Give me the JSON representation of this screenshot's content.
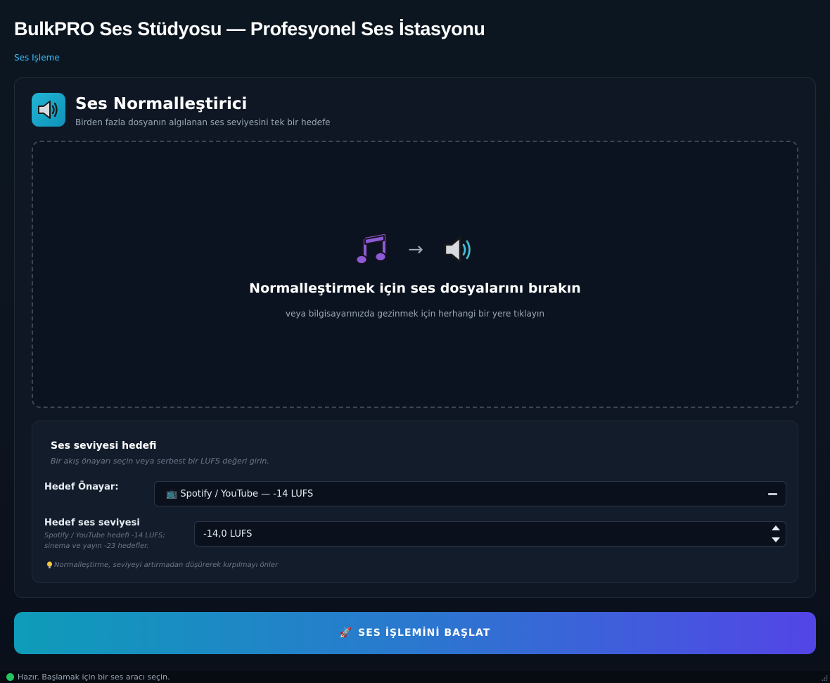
{
  "app": {
    "title": "BulkPRO Ses Stüdyosu — Profesyonel Ses İstasyonu",
    "breadcrumb": "Ses Işleme"
  },
  "tool": {
    "icon": "speaker-icon",
    "title": "Ses Normalleştirici",
    "subtitle": "Birden fazla dosyanın algılanan ses seviyesini tek bir hedefe"
  },
  "dropzone": {
    "icon_left": "music-note-icon",
    "icon_right": "speaker-icon",
    "arrow": "→",
    "title": "Normalleştirmek için ses dosyalarını bırakın",
    "subtitle": "veya bilgisayarınızda gezinmek için herhangi bir yere tıklayın"
  },
  "settings": {
    "title": "Ses seviyesi hedefi",
    "subtitle": "Bir akış önayarı seçin veya serbest bir LUFS değeri girin.",
    "preset_label": "Hedef Önayar:",
    "preset_value": "📺 Spotify / YouTube — -14 LUFS",
    "level_label": "Hedef ses seviyesi",
    "level_help": "Spotify / YouTube hedefi -14 LUFS; sinema ve yayın -23 hedefler.",
    "level_value": "-14,0 LUFS",
    "tip": "Normalleştirme, seviyeyi artırmadan düşürerek kırpılmayı önler"
  },
  "actions": {
    "start_label": "SES İŞLEMİNİ BAŞLAT",
    "start_icon": "🚀"
  },
  "status": {
    "text": "Hazır. Başlamak için bir ses aracı seçin.",
    "color": "#22c55e"
  },
  "colors": {
    "accent": "#38bdf8",
    "button_start": "#0e9cb9",
    "button_end": "#5345e6"
  }
}
